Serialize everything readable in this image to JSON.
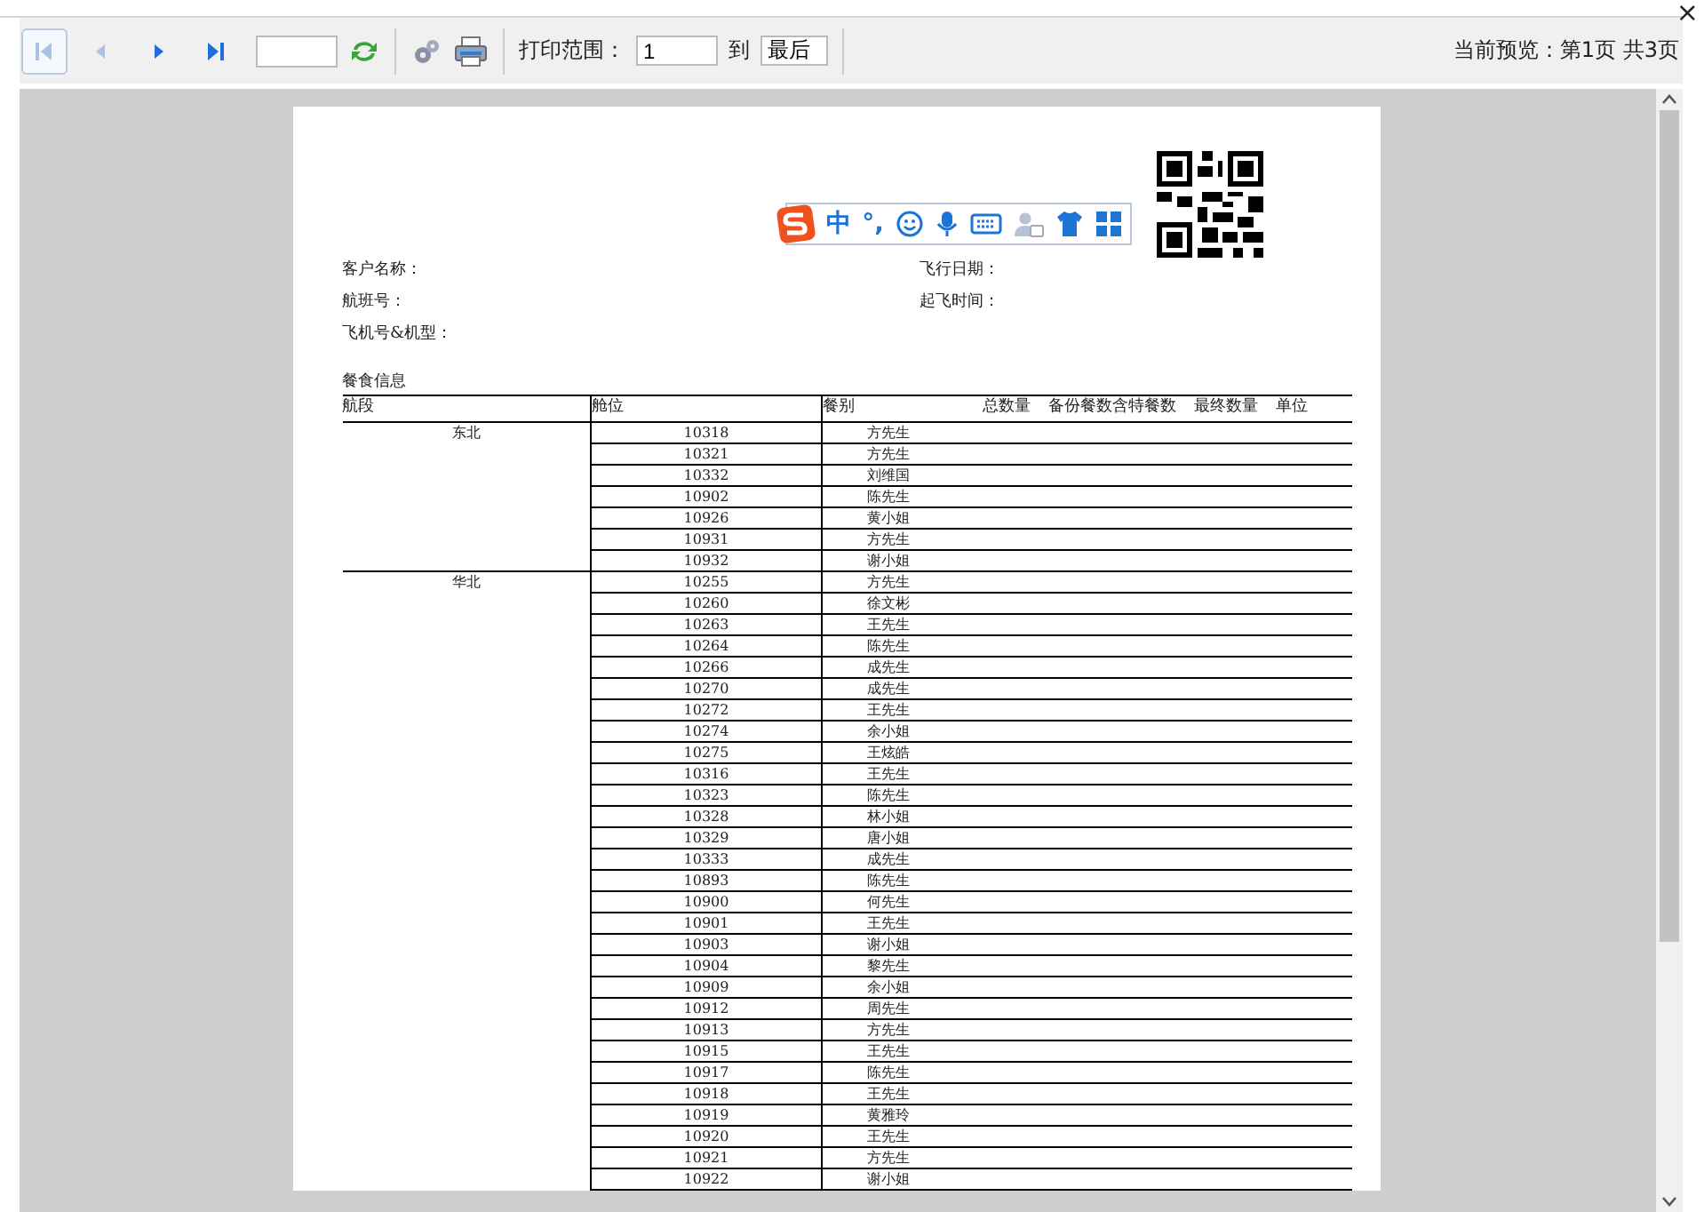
{
  "toolbar": {
    "nav_buttons": [
      {
        "kind": "first",
        "disabled": true
      },
      {
        "kind": "prev",
        "disabled": true
      },
      {
        "kind": "next",
        "disabled": false
      },
      {
        "kind": "last",
        "disabled": false
      }
    ],
    "range_label": "打印范围：",
    "range_from": "1",
    "range_to_label": "到",
    "range_to": "最后",
    "status": "当前预览：第1页 共3页"
  },
  "close": "×",
  "ime_bar": {
    "mode": "中",
    "punct": "°,"
  },
  "report": {
    "fields_left": [
      "客户名称：",
      "航班号：",
      "飞机号&机型："
    ],
    "fields_right": [
      "飞行日期：",
      "起飞时间："
    ],
    "section_title": "餐食信息",
    "columns": [
      "航段",
      "舱位",
      "餐别",
      "总数量",
      "备份餐数含特餐数",
      "最终数量",
      "单位"
    ],
    "groups": [
      {
        "segment": "东北",
        "rows": [
          [
            "10318",
            "方先生"
          ],
          [
            "10321",
            "方先生"
          ],
          [
            "10332",
            "刘维国"
          ],
          [
            "10902",
            "陈先生"
          ],
          [
            "10926",
            "黄小姐"
          ],
          [
            "10931",
            "方先生"
          ],
          [
            "10932",
            "谢小姐"
          ]
        ]
      },
      {
        "segment": "华北",
        "rows": [
          [
            "10255",
            "方先生"
          ],
          [
            "10260",
            "徐文彬"
          ],
          [
            "10263",
            "王先生"
          ],
          [
            "10264",
            "陈先生"
          ],
          [
            "10266",
            "成先生"
          ],
          [
            "10270",
            "成先生"
          ],
          [
            "10272",
            "王先生"
          ],
          [
            "10274",
            "余小姐"
          ],
          [
            "10275",
            "王炫皓"
          ],
          [
            "10316",
            "王先生"
          ],
          [
            "10323",
            "陈先生"
          ],
          [
            "10328",
            "林小姐"
          ],
          [
            "10329",
            "唐小姐"
          ],
          [
            "10333",
            "成先生"
          ],
          [
            "10893",
            "陈先生"
          ],
          [
            "10900",
            "何先生"
          ],
          [
            "10901",
            "王先生"
          ],
          [
            "10903",
            "谢小姐"
          ],
          [
            "10904",
            "黎先生"
          ],
          [
            "10909",
            "余小姐"
          ],
          [
            "10912",
            "周先生"
          ],
          [
            "10913",
            "方先生"
          ],
          [
            "10915",
            "王先生"
          ],
          [
            "10917",
            "陈先生"
          ],
          [
            "10918",
            "王先生"
          ],
          [
            "10919",
            "黄雅玲"
          ],
          [
            "10920",
            "王先生"
          ],
          [
            "10921",
            "方先生"
          ],
          [
            "10922",
            "谢小姐"
          ]
        ]
      }
    ]
  }
}
